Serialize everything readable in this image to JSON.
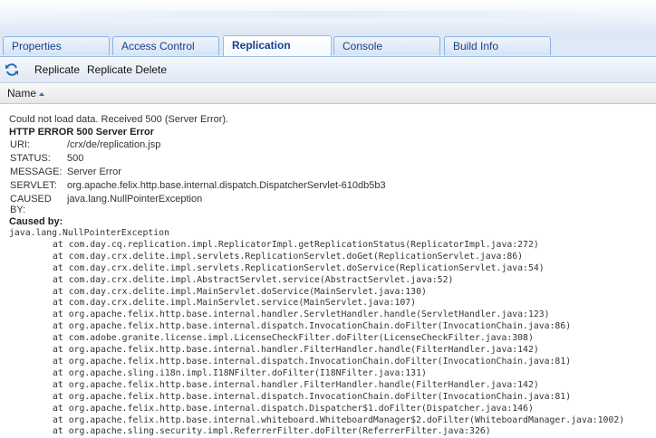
{
  "tabs": [
    {
      "label": "Properties",
      "active": false
    },
    {
      "label": "Access Control",
      "active": false
    },
    {
      "label": "Replication",
      "active": true
    },
    {
      "label": "Console",
      "active": false
    },
    {
      "label": "Build Info",
      "active": false
    }
  ],
  "toolbar": {
    "icon": "refresh-icon",
    "replicate_label": "Replicate",
    "replicate_delete_label": "Replicate Delete"
  },
  "grid": {
    "column_header": "Name",
    "sort": "ascending"
  },
  "error": {
    "message": "Could not load data. Received 500 (Server Error).",
    "title": "HTTP ERROR 500 Server Error",
    "fields": [
      {
        "key": "URI:",
        "value": "/crx/de/replication.jsp"
      },
      {
        "key": "STATUS:",
        "value": "500"
      },
      {
        "key": "MESSAGE:",
        "value": "Server Error"
      },
      {
        "key": "SERVLET:",
        "value": "org.apache.felix.http.base.internal.dispatch.DispatcherServlet-610db5b3"
      },
      {
        "key": "CAUSED BY:",
        "value": "java.lang.NullPointerException"
      }
    ],
    "caused_by_label": "Caused by:",
    "exception": "java.lang.NullPointerException",
    "stack": [
      "at com.day.cq.replication.impl.ReplicatorImpl.getReplicationStatus(ReplicatorImpl.java:272)",
      "at com.day.crx.delite.impl.servlets.ReplicationServlet.doGet(ReplicationServlet.java:86)",
      "at com.day.crx.delite.impl.servlets.ReplicationServlet.doService(ReplicationServlet.java:54)",
      "at com.day.crx.delite.impl.AbstractServlet.service(AbstractServlet.java:52)",
      "at com.day.crx.delite.impl.MainServlet.doService(MainServlet.java:130)",
      "at com.day.crx.delite.impl.MainServlet.service(MainServlet.java:107)",
      "at org.apache.felix.http.base.internal.handler.ServletHandler.handle(ServletHandler.java:123)",
      "at org.apache.felix.http.base.internal.dispatch.InvocationChain.doFilter(InvocationChain.java:86)",
      "at com.adobe.granite.license.impl.LicenseCheckFilter.doFilter(LicenseCheckFilter.java:308)",
      "at org.apache.felix.http.base.internal.handler.FilterHandler.handle(FilterHandler.java:142)",
      "at org.apache.felix.http.base.internal.dispatch.InvocationChain.doFilter(InvocationChain.java:81)",
      "at org.apache.sling.i18n.impl.I18NFilter.doFilter(I18NFilter.java:131)",
      "at org.apache.felix.http.base.internal.handler.FilterHandler.handle(FilterHandler.java:142)",
      "at org.apache.felix.http.base.internal.dispatch.InvocationChain.doFilter(InvocationChain.java:81)",
      "at org.apache.felix.http.base.internal.dispatch.Dispatcher$1.doFilter(Dispatcher.java:146)",
      "at org.apache.felix.http.base.internal.whiteboard.WhiteboardManager$2.doFilter(WhiteboardManager.java:1002)",
      "at org.apache.sling.security.impl.ReferrerFilter.doFilter(ReferrerFilter.java:326)"
    ]
  }
}
